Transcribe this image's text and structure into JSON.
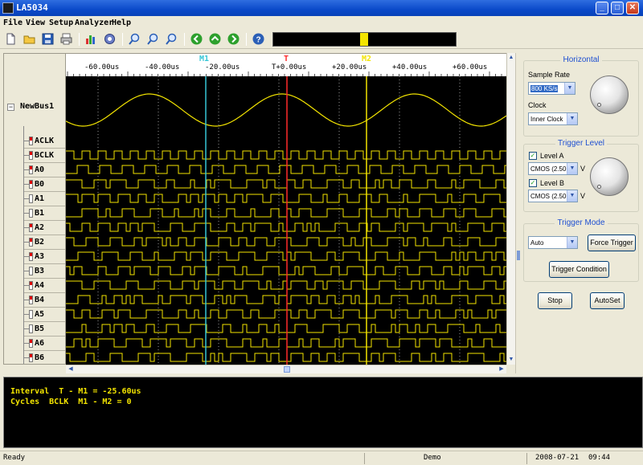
{
  "window": {
    "title": "LA5034"
  },
  "menu": [
    "File",
    "View",
    "Setup",
    "Analyzer",
    "Help"
  ],
  "ruler": {
    "ticks": [
      "-60.00us",
      "-40.00us",
      "-20.00us",
      "T+0.00us",
      "+20.00us",
      "+40.00us",
      "+60.00us"
    ],
    "cursors": {
      "m1": "M1",
      "t": "T",
      "m2": "M2"
    }
  },
  "channels": {
    "bus": "NewBus1",
    "list": [
      {
        "name": "ACLK",
        "probe": "red"
      },
      {
        "name": "BCLK",
        "probe": "red"
      },
      {
        "name": "A0",
        "probe": "red"
      },
      {
        "name": "B0",
        "probe": "red"
      },
      {
        "name": "A1",
        "probe": "white"
      },
      {
        "name": "B1",
        "probe": "white"
      },
      {
        "name": "A2",
        "probe": "red"
      },
      {
        "name": "B2",
        "probe": "red"
      },
      {
        "name": "A3",
        "probe": "red"
      },
      {
        "name": "B3",
        "probe": "white"
      },
      {
        "name": "A4",
        "probe": "red"
      },
      {
        "name": "B4",
        "probe": "red"
      },
      {
        "name": "A5",
        "probe": "white"
      },
      {
        "name": "B5",
        "probe": "white"
      },
      {
        "name": "A6",
        "probe": "red"
      },
      {
        "name": "B6",
        "probe": "red"
      }
    ]
  },
  "horizontal": {
    "title": "Horizontal",
    "sample_rate_label": "Sample Rate",
    "sample_rate": "800 KS/s",
    "clock_label": "Clock",
    "clock": "Inner Clock"
  },
  "trigger_level": {
    "title": "Trigger Level",
    "level_a_label": "Level A",
    "level_a": "CMOS (2.50",
    "level_b_label": "Level B",
    "level_b": "CMOS (2.50",
    "unit": "V"
  },
  "trigger_mode": {
    "title": "Trigger Mode",
    "mode": "Auto",
    "force_trigger": "Force Trigger",
    "trigger_condition": "Trigger Condition"
  },
  "buttons": {
    "stop": "Stop",
    "autoset": "AutoSet"
  },
  "info": {
    "line1": "Interval  T - M1 = -25.60us",
    "line2": "Cycles  BCLK  M1 - M2 = 0"
  },
  "status": {
    "left": "Ready",
    "mid": "Demo",
    "date": "2008-07-21",
    "time": "09:44"
  },
  "colors": {
    "trace": "#f3e400",
    "m1": "#35c6d6",
    "t": "#ff2a2a",
    "grid": "#9a9a9a"
  }
}
